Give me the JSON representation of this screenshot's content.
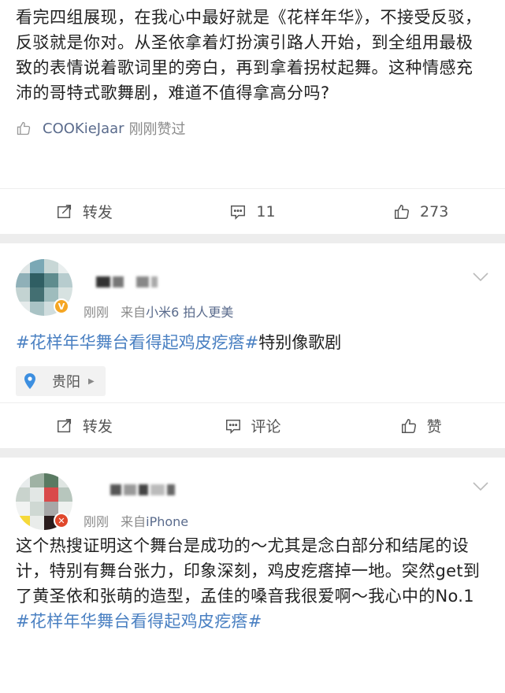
{
  "post1": {
    "text": "看完四组展现，在我心中最好就是《花样年华》，不接受反驳，反驳就是你对。从圣依拿着灯扮演引路人开始，到全组用最极致的表情说着歌词里的旁白，再到拿着拐杖起舞。这种情感充沛的哥特式歌舞剧，难道不值得拿高分吗?",
    "liked_user": "COOKieJaar",
    "liked_suffix": "刚刚赞过",
    "repost_label": "转发",
    "comment_count": "11",
    "like_count": "273"
  },
  "post2": {
    "time": "刚刚",
    "from_prefix": "来自",
    "source": "小米6 拍人更美",
    "hashtag": "#花样年华舞台看得起鸡皮疙瘩#",
    "text": "特别像歌剧",
    "location": "贵阳",
    "repost_label": "转发",
    "comment_label": "评论",
    "like_label": "赞"
  },
  "post3": {
    "time": "刚刚",
    "from_prefix": "来自",
    "source": "iPhone",
    "text": "这个热搜证明这个舞台是成功的～尤其是念白部分和结尾的设计，特别有舞台张力，印象深刻，鸡皮疙瘩掉一地。突然get到了黄圣依和张萌的造型，孟佳的嗓音我很爱啊～我心中的No.1 ",
    "hashtag": "#花样年华舞台看得起鸡皮疙瘩#"
  },
  "colors": {
    "link": "#4a80c2",
    "username": "#5a6b8c",
    "meta_gray": "#8a8a8a",
    "divider": "#ededed",
    "verified_orange": "#f5a623",
    "verified_red": "#e0472b"
  }
}
